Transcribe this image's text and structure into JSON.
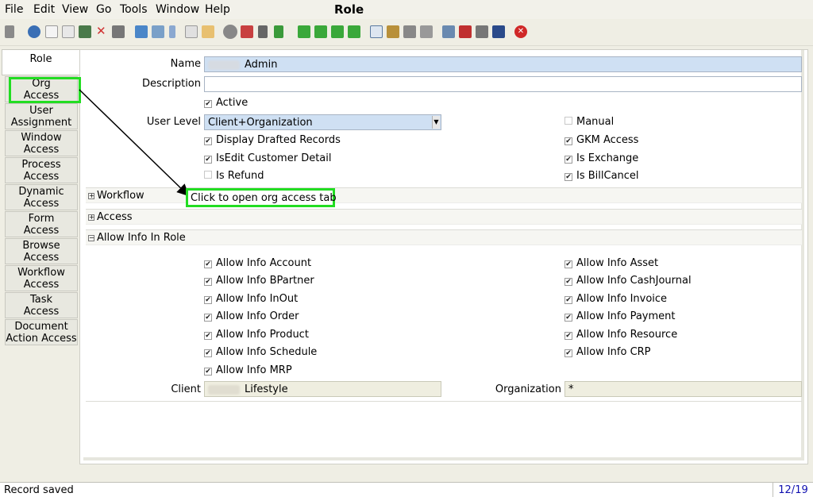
{
  "menu": [
    "File",
    "Edit",
    "View",
    "Go",
    "Tools",
    "Window",
    "Help"
  ],
  "window_title": "Role",
  "toolbar_icons": [
    "undo-icon",
    "help-icon",
    "new-icon",
    "copy-icon",
    "save-icon",
    "delete-icon",
    "ignore-icon",
    "refresh-icon",
    "find-icon",
    "attachment-icon",
    "chat-icon",
    "history-icon",
    "report-icon",
    "home-icon",
    "back-icon",
    "forward-icon",
    "first-record-icon",
    "previous-record-icon",
    "next-record-icon",
    "last-record-icon",
    "form-view-icon",
    "archive-icon",
    "print-icon",
    "print-preview-icon",
    "zoom-across-icon",
    "workflow-icon",
    "request-icon",
    "product-info-icon",
    "exit-icon"
  ],
  "tabs": [
    [
      "Role"
    ],
    [
      "Org",
      "Access"
    ],
    [
      "User",
      "Assignment"
    ],
    [
      "Window",
      "Access"
    ],
    [
      "Process",
      "Access"
    ],
    [
      "Dynamic",
      "Access"
    ],
    [
      "Form",
      "Access"
    ],
    [
      "Browse",
      "Access"
    ],
    [
      "Workflow",
      "Access"
    ],
    [
      "Task",
      "Access"
    ],
    [
      "Document",
      "Action Access"
    ]
  ],
  "form": {
    "name_label": "Name",
    "name_value": "Admin",
    "description_label": "Description",
    "description_value": "",
    "active_label": "Active",
    "user_level_label": "User Level",
    "user_level_value": "Client+Organization",
    "manual_label": "Manual",
    "display_drafted_label": "Display Drafted Records",
    "gkm_access_label": "GKM Access",
    "isedit_customer_label": "IsEdit Customer Detail",
    "is_exchange_label": "Is Exchange",
    "is_refund_label": "Is Refund",
    "is_billcancel_label": "Is BillCancel",
    "client_label": "Client",
    "client_value": "Lifestyle",
    "organization_label": "Organization",
    "organization_value": "*"
  },
  "sections": {
    "workflow": "Workflow",
    "access": "Access",
    "allow_info": "Allow Info In Role"
  },
  "allow_info_left": [
    "Allow Info Account",
    "Allow Info BPartner",
    "Allow Info InOut",
    "Allow Info Order",
    "Allow Info Product",
    "Allow Info Schedule",
    "Allow Info MRP"
  ],
  "allow_info_right": [
    "Allow Info Asset",
    "Allow Info CashJournal",
    "Allow Info Invoice",
    "Allow Info Payment",
    "Allow Info Resource",
    "Allow Info CRP"
  ],
  "callout_text": "Click to open org access tab",
  "status": {
    "message": "Record saved",
    "record_count": "12/19"
  },
  "colors": {
    "highlight": "#22dd22",
    "name_field_bg": "#cfe0f3",
    "status_count": "#1010b0"
  }
}
